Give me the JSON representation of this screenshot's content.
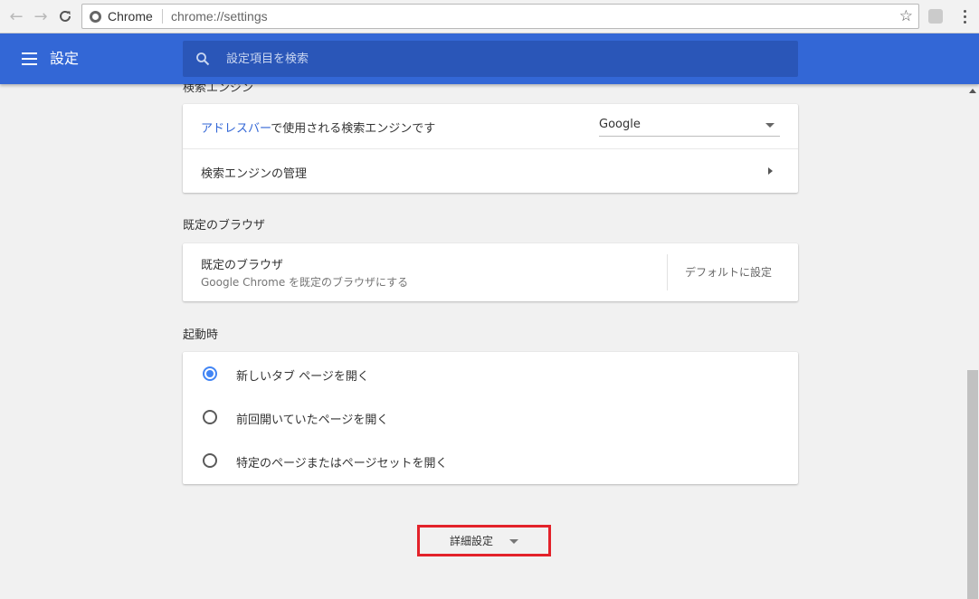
{
  "browser": {
    "back_glyph": "←",
    "forward_glyph": "→",
    "reload_glyph": "C",
    "site_label": "Chrome",
    "url": "chrome://settings",
    "star_glyph": "☆"
  },
  "header": {
    "title": "設定",
    "search_placeholder": "設定項目を検索"
  },
  "search_engine": {
    "section_title": "検索エンジン",
    "address_bar_link": "アドレスバー",
    "address_bar_rest": "で使用される検索エンジンです",
    "selected_engine": "Google",
    "manage_label": "検索エンジンの管理"
  },
  "default_browser": {
    "section_title": "既定のブラウザ",
    "title": "既定のブラウザ",
    "subtitle": "Google Chrome を既定のブラウザにする",
    "button_label": "デフォルトに設定"
  },
  "startup": {
    "section_title": "起動時",
    "options": [
      {
        "label": "新しいタブ ページを開く",
        "checked": true
      },
      {
        "label": "前回開いていたページを開く",
        "checked": false
      },
      {
        "label": "特定のページまたはページセットを開く",
        "checked": false
      }
    ]
  },
  "advanced": {
    "label": "詳細設定"
  },
  "colors": {
    "header_blue": "#3367d6",
    "radio_blue": "#4285f4",
    "highlight_red": "#e3222a"
  }
}
